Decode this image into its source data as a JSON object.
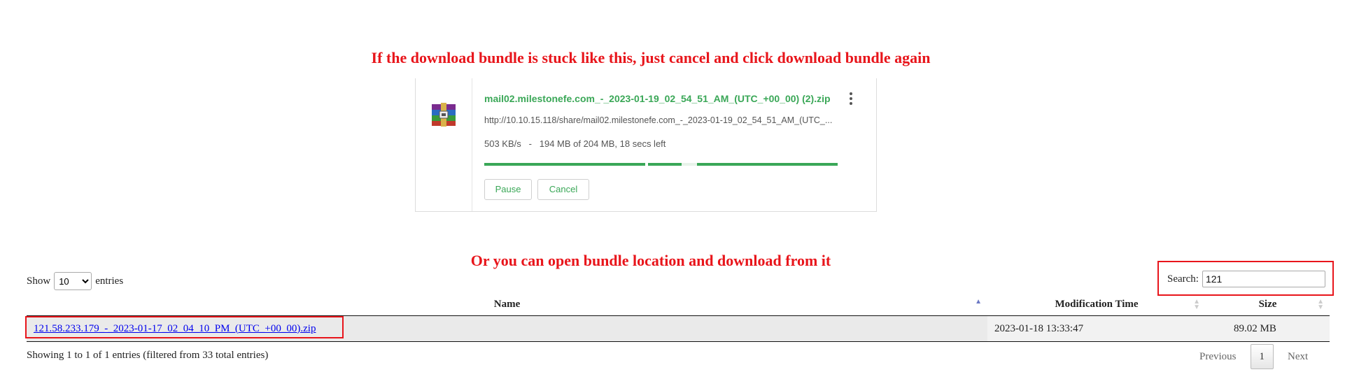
{
  "annotations": {
    "top": "If the download bundle is stuck like this, just cancel and click download bundle again",
    "bottom": "Or you can open bundle location and download from it"
  },
  "download": {
    "filename": "mail02.milestonefe.com_-_2023-01-19_02_54_51_AM_(UTC_+00_00) (2).zip",
    "url": "http://10.10.15.118/share/mail02.milestonefe.com_-_2023-01-19_02_54_51_AM_(UTC_...",
    "status": "503 KB/s   -   194 MB of 204 MB, 18 secs left",
    "progress": 0.95,
    "pause_label": "Pause",
    "cancel_label": "Cancel",
    "file_icon": "archive-icon",
    "menu_icon": "more-vert-icon",
    "accent_color": "#3aa757"
  },
  "table_controls": {
    "show_label": "Show",
    "entries_label": "entries",
    "page_length": "10",
    "search_label": "Search:",
    "search_value": "121"
  },
  "table": {
    "columns": [
      "Name",
      "Modification Time",
      "Size"
    ],
    "rows": [
      {
        "name": "121.58.233.179_-_2023-01-17_02_04_10_PM_(UTC_+00_00).zip",
        "modified": "2023-01-18 13:33:47",
        "size": "89.02 MB"
      }
    ]
  },
  "footer": {
    "info": "Showing 1 to 1 of 1 entries (filtered from 33 total entries)",
    "previous_label": "Previous",
    "current_page": "1",
    "next_label": "Next"
  },
  "highlight_color": "#e8151b"
}
